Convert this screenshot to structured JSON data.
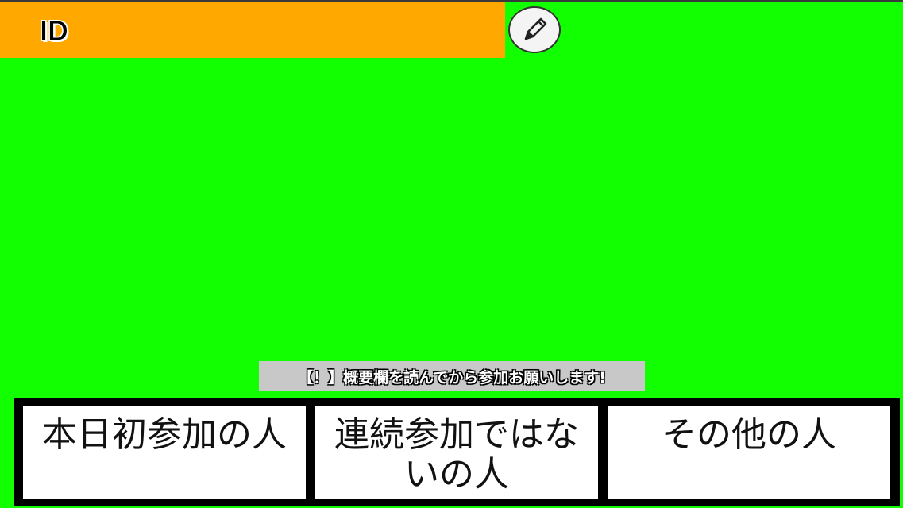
{
  "header": {
    "id_label": "ID",
    "edit_icon": "pencil-icon"
  },
  "notice": {
    "text": "【！】概要欄を読んでから参加お願いします!"
  },
  "choices": [
    {
      "label": "本日初参加の人"
    },
    {
      "label": "連続参加ではないの人"
    },
    {
      "label": "その他の人"
    }
  ],
  "colors": {
    "background": "#11ff00",
    "id_bar": "#ffa800",
    "notice_bg": "#c8c8c8",
    "panel_border": "#000000",
    "choice_bg": "#ffffff"
  }
}
